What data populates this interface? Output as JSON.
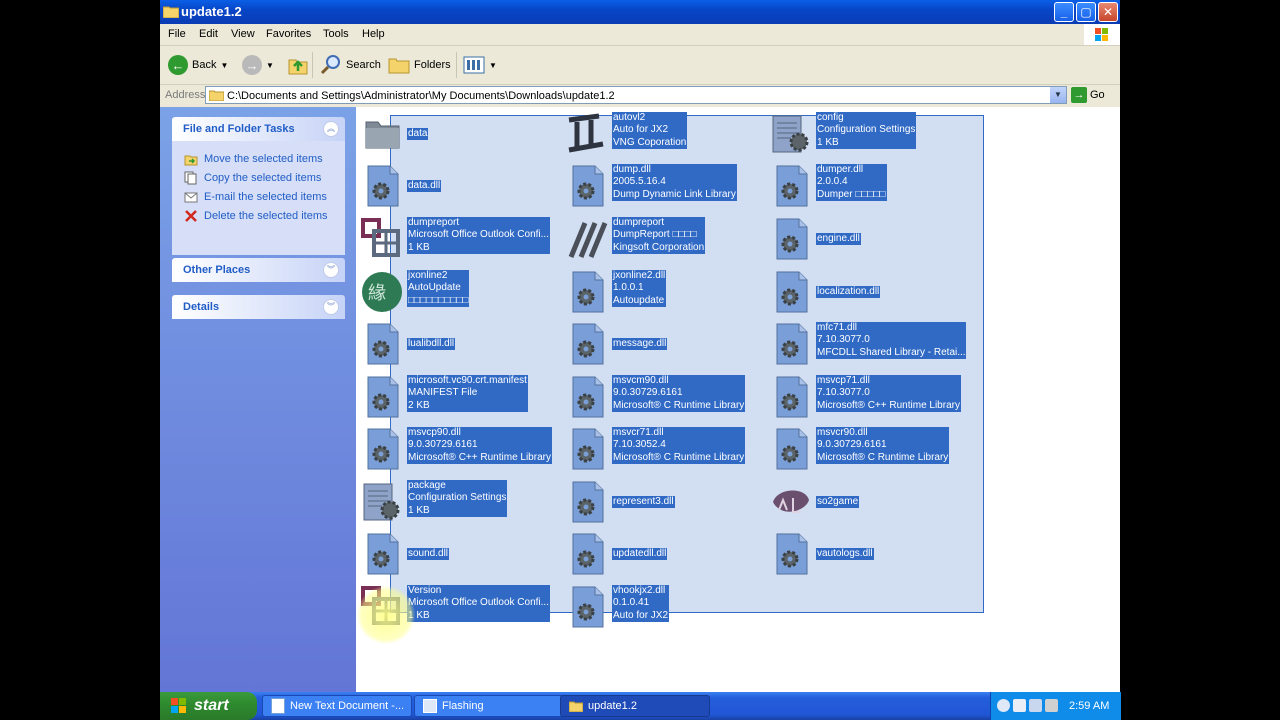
{
  "window": {
    "title": "update1.2"
  },
  "menu": [
    "File",
    "Edit",
    "View",
    "Favorites",
    "Tools",
    "Help"
  ],
  "toolbar": {
    "back_label": "Back",
    "search_label": "Search",
    "folders_label": "Folders"
  },
  "address": {
    "label": "Address",
    "value": "C:\\Documents and Settings\\Administrator\\My Documents\\Downloads\\update1.2",
    "go_label": "Go"
  },
  "leftpane": {
    "file_tasks": {
      "title": "File and Folder Tasks",
      "items": [
        "Move the selected items",
        "Copy the selected items",
        "E-mail the selected items",
        "Delete the selected items"
      ]
    },
    "other_places": {
      "title": "Other Places"
    },
    "details": {
      "title": "Details"
    }
  },
  "files": [
    {
      "lines": [
        "data"
      ],
      "icon": "folder-icon"
    },
    {
      "lines": [
        "autovl2",
        "Auto for JX2",
        "VNG Coporation"
      ],
      "icon": "autovl-icon"
    },
    {
      "lines": [
        "config",
        "Configuration Settings",
        "1 KB"
      ],
      "icon": "config-file-icon"
    },
    {
      "lines": [
        "data.dll"
      ],
      "icon": "dll-icon"
    },
    {
      "lines": [
        "dump.dll",
        "2005.5.16.4",
        "Dump Dynamic Link Library"
      ],
      "icon": "dll-icon"
    },
    {
      "lines": [
        "dumper.dll",
        "2.0.0.4",
        "Dumper □□□□□"
      ],
      "icon": "dll-icon"
    },
    {
      "lines": [
        "dumpreport",
        "Microsoft Office Outlook Confi...",
        "1 KB"
      ],
      "icon": "outlook-config-icon"
    },
    {
      "lines": [
        "dumpreport",
        "DumpReport □□□□",
        "Kingsoft Corporation"
      ],
      "icon": "dumpreport-icon"
    },
    {
      "lines": [
        "engine.dll"
      ],
      "icon": "dll-icon"
    },
    {
      "lines": [
        "jxonline2",
        "AutoUpdate",
        "□□□□□□□□□□"
      ],
      "icon": "jxonline-icon"
    },
    {
      "lines": [
        "jxonline2.dll",
        "1.0.0.1",
        "Autoupdate"
      ],
      "icon": "dll-icon"
    },
    {
      "lines": [
        "localization.dll"
      ],
      "icon": "dll-icon"
    },
    {
      "lines": [
        "lualibdll.dll"
      ],
      "icon": "dll-icon"
    },
    {
      "lines": [
        "message.dll"
      ],
      "icon": "dll-icon"
    },
    {
      "lines": [
        "mfc71.dll",
        "7.10.3077.0",
        "MFCDLL Shared Library - Retai..."
      ],
      "icon": "dll-icon"
    },
    {
      "lines": [
        "microsoft.vc90.crt.manifest",
        "MANIFEST File",
        "2 KB"
      ],
      "icon": "dll-icon"
    },
    {
      "lines": [
        "msvcm90.dll",
        "9.0.30729.6161",
        "Microsoft® C Runtime Library"
      ],
      "icon": "dll-icon"
    },
    {
      "lines": [
        "msvcp71.dll",
        "7.10.3077.0",
        "Microsoft® C++ Runtime Library"
      ],
      "icon": "dll-icon"
    },
    {
      "lines": [
        "msvcp90.dll",
        "9.0.30729.6161",
        "Microsoft® C++ Runtime Library"
      ],
      "icon": "dll-icon"
    },
    {
      "lines": [
        "msvcr71.dll",
        "7.10.3052.4",
        "Microsoft® C Runtime Library"
      ],
      "icon": "dll-icon"
    },
    {
      "lines": [
        "msvcr90.dll",
        "9.0.30729.6161",
        "Microsoft® C Runtime Library"
      ],
      "icon": "dll-icon"
    },
    {
      "lines": [
        "package",
        "Configuration Settings",
        "1 KB"
      ],
      "icon": "config-file-icon"
    },
    {
      "lines": [
        "represent3.dll"
      ],
      "icon": "dll-icon"
    },
    {
      "lines": [
        "so2game"
      ],
      "icon": "so2game-icon"
    },
    {
      "lines": [
        "sound.dll"
      ],
      "icon": "dll-icon"
    },
    {
      "lines": [
        "updatedll.dll"
      ],
      "icon": "dll-icon"
    },
    {
      "lines": [
        "vautologs.dll"
      ],
      "icon": "dll-icon"
    },
    {
      "lines": [
        "Version",
        "Microsoft Office Outlook Confi...",
        "1 KB"
      ],
      "icon": "outlook-config-icon"
    },
    {
      "lines": [
        "vhookjx2.dll",
        "0.1.0.41",
        "Auto for JX2"
      ],
      "icon": "dll-icon"
    }
  ],
  "taskbar": {
    "start_label": "start",
    "buttons": [
      "New Text Document -...",
      "Flashing",
      "update1.2"
    ],
    "clock": "2:59 AM"
  },
  "colors": {
    "selection": "#316ac5",
    "titlebar": "#0a5fe6",
    "taskbar": "#245edb",
    "start": "#2e8b2e"
  }
}
